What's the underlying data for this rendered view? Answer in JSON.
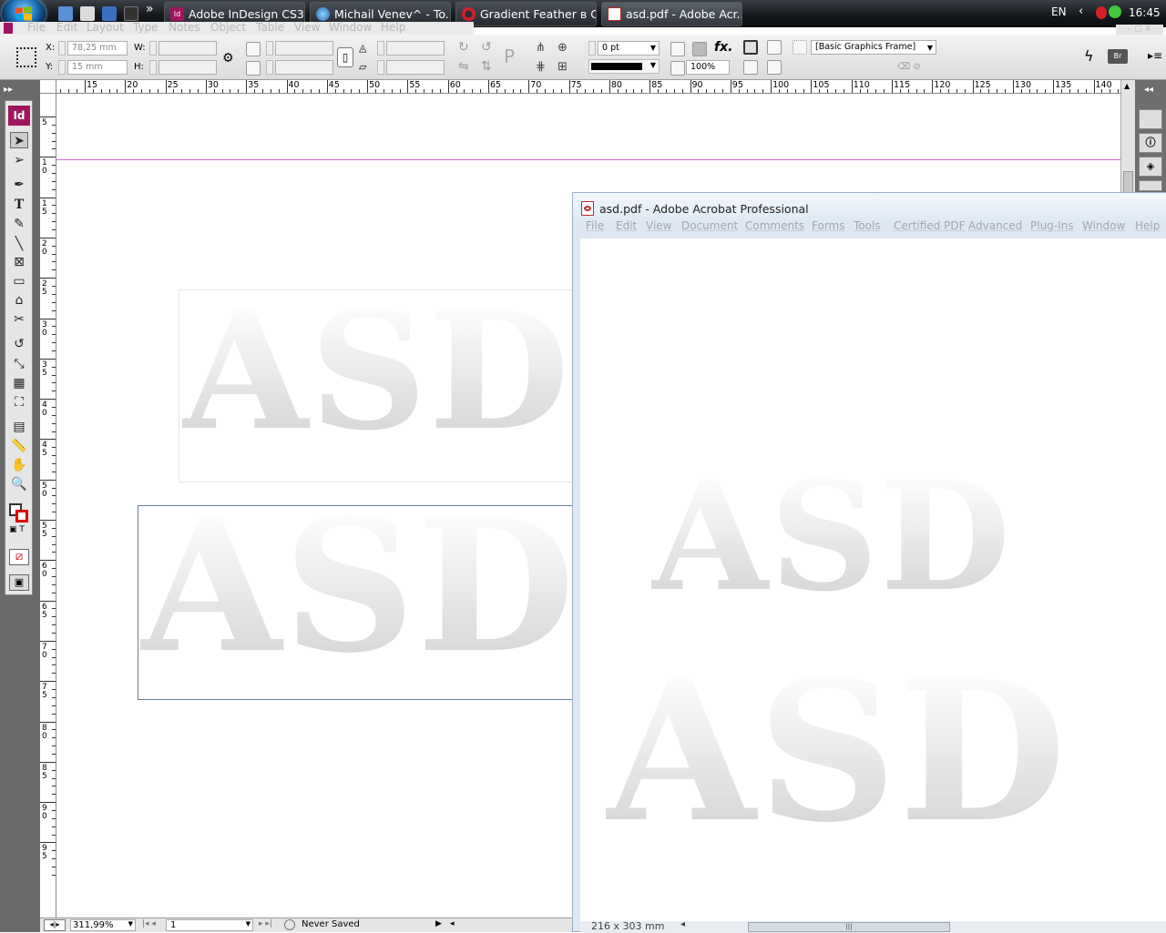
{
  "taskbar": {
    "buttons": [
      {
        "label": "Adobe InDesign CS3..."
      },
      {
        "label": "Michail Venev^ - To..."
      },
      {
        "label": "Gradient Feather в C..."
      },
      {
        "label": "asd.pdf - Adobe Acr..."
      }
    ],
    "overflow": "»",
    "lang": "EN",
    "clock": "16:45"
  },
  "indesign": {
    "menu": [
      "File",
      "Edit",
      "Layout",
      "Type",
      "Notes",
      "Object",
      "Table",
      "View",
      "Window",
      "Help"
    ],
    "control": {
      "x_label": "X:",
      "x_value": "78,25 mm",
      "y_label": "Y:",
      "y_value": "15 mm",
      "w_label": "W:",
      "h_label": "H:",
      "stroke_weight": "0 pt",
      "opacity": "100%",
      "object_style": "[Basic Graphics Frame]"
    },
    "ruler_numbers": [
      "15",
      "20",
      "25",
      "30",
      "35",
      "40",
      "45",
      "50",
      "55",
      "60",
      "65",
      "70",
      "75",
      "80",
      "85",
      "90",
      "95",
      "100",
      "105",
      "110",
      "115",
      "120",
      "125",
      "130",
      "135",
      "140"
    ],
    "vruler_numbers": [
      "5",
      "1\n0",
      "1\n5",
      "2\n0",
      "2\n5",
      "3\n0",
      "3\n5",
      "4\n0",
      "4\n5",
      "5\n0",
      "5\n5",
      "6\n0",
      "6\n5",
      "7\n0",
      "7\n5",
      "8\n0",
      "8\n5",
      "9\n0",
      "9\n5"
    ],
    "ghost_text_top": "ASD",
    "ghost_text_bottom": "ASD",
    "status": {
      "zoom": "311,99%",
      "page": "1",
      "save_state": "Never Saved"
    }
  },
  "acrobat": {
    "title": "asd.pdf - Adobe Acrobat Professional",
    "menu": [
      "File",
      "Edit",
      "View",
      "Document",
      "Comments",
      "Forms",
      "Tools",
      "Certified PDF",
      "Advanced",
      "Plug-Ins",
      "Window",
      "Help"
    ],
    "doc_text_top": "ASD",
    "doc_text_bottom": "ASD",
    "page_size": "216 x 303 mm"
  },
  "colors": {
    "margin_guide": "#d26ad2",
    "indesign_icon": "#a0155d",
    "acrobat_icon": "#c0272d"
  }
}
